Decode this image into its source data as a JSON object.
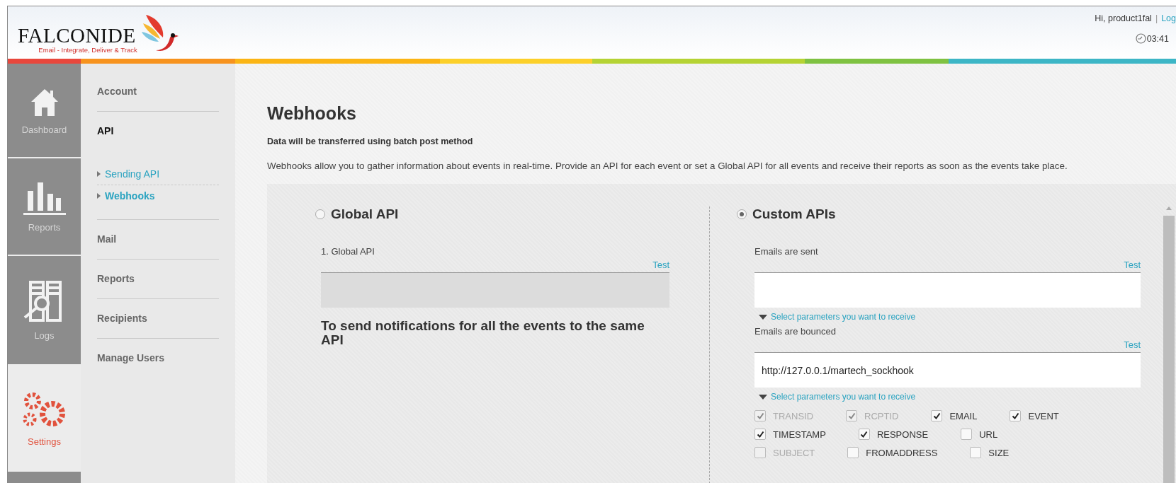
{
  "header": {
    "brand": "FALCONIDE",
    "tagline": "Email - Integrate, Deliver & Track",
    "greeting": "Hi, product1fal",
    "separator": "|",
    "logout_link": "Log",
    "time": "03:41"
  },
  "nav_tiles": [
    {
      "label": "Dashboard",
      "kind": "home",
      "selected": false
    },
    {
      "label": "Reports",
      "kind": "chart",
      "selected": false
    },
    {
      "label": "Logs",
      "kind": "logs",
      "selected": false
    },
    {
      "label": "Settings",
      "kind": "gears",
      "selected": true
    }
  ],
  "submenu": [
    {
      "label": "Account",
      "selected": false
    },
    {
      "label": "API",
      "selected": true,
      "children": [
        {
          "label": "Sending API",
          "selected": false
        },
        {
          "label": "Webhooks",
          "selected": true
        }
      ]
    },
    {
      "label": "Mail",
      "selected": false
    },
    {
      "label": "Reports",
      "selected": false
    },
    {
      "label": "Recipients",
      "selected": false
    },
    {
      "label": "Manage Users",
      "selected": false
    }
  ],
  "page": {
    "title": "Webhooks",
    "subtitle": "Data will be transferred using batch post method",
    "description": "Webhooks allow you to gather information about events in real-time. Provide an API for each event or set a Global API for all events and receive their reports as soon as the events take place."
  },
  "global_api": {
    "label": "Global API",
    "selected": false,
    "field_label": "1. Global API",
    "test_link": "Test",
    "disabled": true,
    "note": "To send notifications for all the events to the same API"
  },
  "custom_apis": {
    "label": "Custom APIs",
    "selected": true,
    "events": [
      {
        "label": "Emails are sent",
        "test_link": "Test",
        "params_toggle": "Select parameters you want to receive"
      },
      {
        "label": "Emails are bounced",
        "test_link": "Test",
        "value": "http://127.0.0.1/martech_sockhook",
        "params_toggle": "Select parameters you want to receive",
        "params": [
          {
            "label": "TRANSID",
            "checked": true,
            "disabled": true
          },
          {
            "label": "RCPTID",
            "checked": true,
            "disabled": true
          },
          {
            "label": "EMAIL",
            "checked": true,
            "disabled": false
          },
          {
            "label": "EVENT",
            "checked": true,
            "disabled": false
          },
          {
            "label": "TIMESTAMP",
            "checked": true,
            "disabled": false
          },
          {
            "label": "RESPONSE",
            "checked": true,
            "disabled": false
          },
          {
            "label": "URL",
            "checked": false,
            "disabled": false
          },
          {
            "label": "SUBJECT",
            "checked": false,
            "disabled": true
          },
          {
            "label": "FROMADDRESS",
            "checked": false,
            "disabled": false
          },
          {
            "label": "SIZE",
            "checked": false,
            "disabled": false
          }
        ]
      }
    ]
  }
}
